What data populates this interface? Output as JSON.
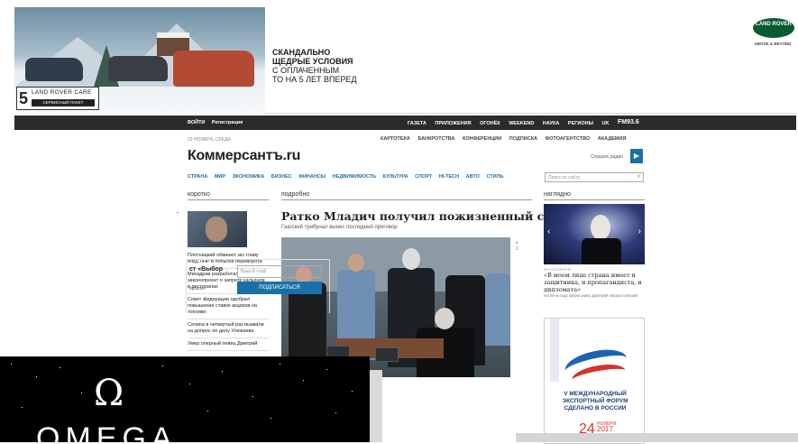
{
  "banner": {
    "care_number": "5",
    "care_title": "LAND ROVER CARE",
    "care_sub": "СЕРВИСНЫЙ ПАКЕТ",
    "promo_lines": [
      "СКАНДАЛЬНО",
      "ЩЕДРЫЕ УСЛОВИЯ",
      "С ОПЛАЧЕННЫМ",
      "ТО НА 5 ЛЕТ ВПЕРЕД"
    ],
    "logo_text": "LAND ROVER",
    "logo_tag": "ABOVE & BEYOND"
  },
  "topbar": {
    "login": "ВОЙТИ",
    "register": "Регистрация",
    "links": [
      "ГАЗЕТА",
      "ПРИЛОЖЕНИЯ",
      "ОГОНЁК",
      "WEEKEND",
      "НАУКА",
      "РЕГИОНЫ",
      "UK"
    ],
    "fm": "FM93.6"
  },
  "site": {
    "date": "22 НОЯБРЯ, СРЕДА",
    "logo": "Коммерсантъ.ru",
    "services": [
      "КАРТОТЕКА",
      "БАНКРОТСТВА",
      "КОНФЕРЕНЦИИ",
      "ПОДПИСКА",
      "ФОТОАГЕНТСТВО",
      "АКАДЕМИЯ"
    ],
    "listen": "Слушать радио",
    "nav": [
      "СТРАНА",
      "МИР",
      "ЭКОНОМИКА",
      "БИЗНЕС",
      "ФИНАНСЫ",
      "НЕДВИЖИМОСТЬ",
      "КУЛЬТУРА",
      "СПОРТ",
      "HI-TECH",
      "АВТО",
      "СТИЛЬ"
    ],
    "search_placeholder": "Поиск по сайту"
  },
  "columns": {
    "short": "коротко",
    "detail": "подробно",
    "visual": "наглядно"
  },
  "short_items": [
    "Плотницкий обвинил экс-главу МВД ЛНР в попытке переворота",
    "Минздрав разработал законопроект о запрете кальянов в ресторанах",
    "Совет федерации одобрил повышение ставок акцизов на топливо",
    "Сечина в четвертый раз вызвали на допрос по делу Улюкаева",
    "Умер оперный певец Дмитрий"
  ],
  "main": {
    "title": "Ратко Младич получил пожизненный срок",
    "subtitle": "Гаагский трибунал вынес последний приговор",
    "comments": "2"
  },
  "subscribe": {
    "text": "ст «Выбор",
    "text2": "ерском",
    "placeholder": "Ваш E-mail",
    "button": "ПОДПИСАТЬСЯ"
  },
  "visual": {
    "tag": "ФОТОГАЛЕРЕЯ",
    "quote": "«В моем лице страна имеет и защитника, и пропагандиста, и дипломата»",
    "caption": "На 56-м году жизни умер Дмитрий Хворостовский"
  },
  "forum_ad": {
    "title_lines": [
      "V МЕЖДУНАРОДНЫЙ",
      "ЭКСПОРТНЫЙ ФОРУМ",
      "СДЕЛАНО В РОССИИ"
    ],
    "day": "24",
    "month": "НОЯБРЯ",
    "year": "2017"
  },
  "omega": {
    "symbol": "Ω",
    "word": "OMEGA"
  }
}
